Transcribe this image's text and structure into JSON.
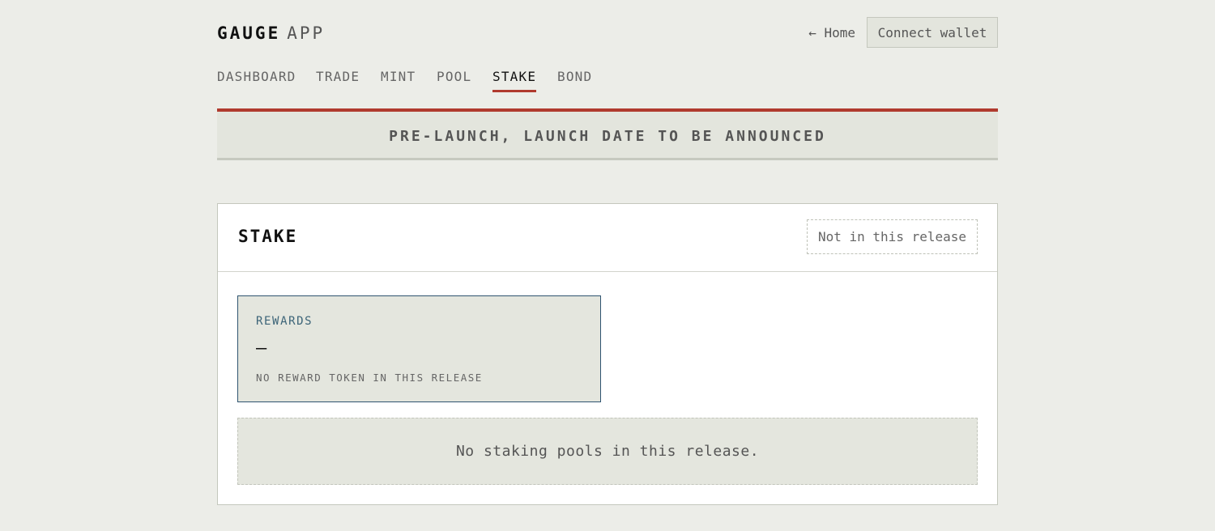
{
  "header": {
    "brand_strong": "GAUGE",
    "brand_light": "APP",
    "home_link": "← Home",
    "connect_button": "Connect wallet"
  },
  "nav": {
    "items": [
      {
        "label": "DASHBOARD"
      },
      {
        "label": "TRADE"
      },
      {
        "label": "MINT"
      },
      {
        "label": "POOL"
      },
      {
        "label": "STAKE"
      },
      {
        "label": "BOND"
      }
    ],
    "active": "STAKE"
  },
  "banner": {
    "text": "PRE-LAUNCH, LAUNCH DATE TO BE ANNOUNCED"
  },
  "card": {
    "title": "STAKE",
    "release_tag": "Not in this release",
    "rewards": {
      "label": "REWARDS",
      "value": "—",
      "note": "NO REWARD TOKEN IN THIS RELEASE"
    },
    "empty_pools": "No staking pools in this release."
  },
  "colors": {
    "background": "#ecede8",
    "accent_red": "#b03a2e",
    "rewards_border": "#2f5470",
    "panel": "#e4e6de"
  }
}
